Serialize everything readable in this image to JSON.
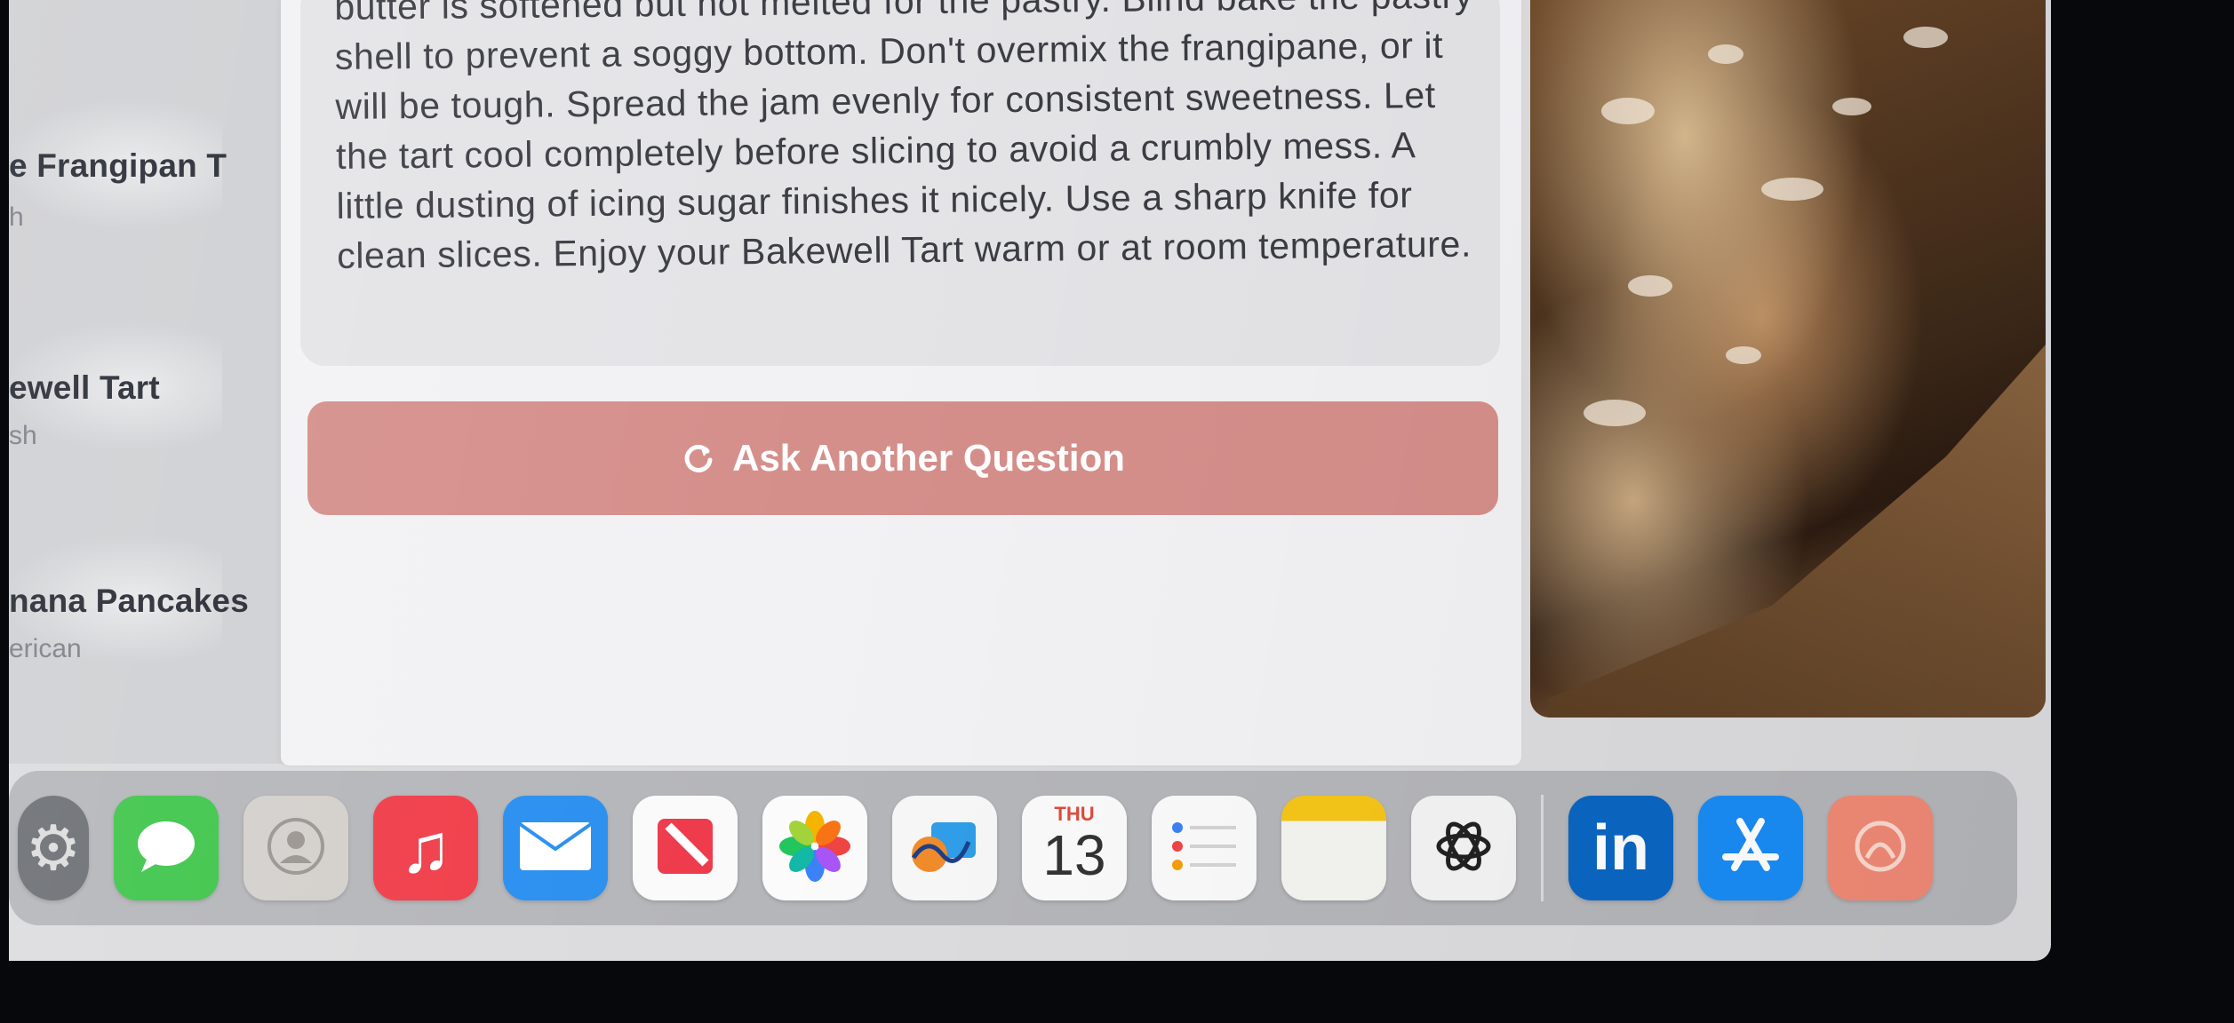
{
  "sidebar": {
    "items": [
      {
        "title": "e Frangipan T",
        "subtitle": "h"
      },
      {
        "title": "ewell Tart",
        "subtitle": "sh"
      },
      {
        "title": "nana Pancakes",
        "subtitle": "erican"
      }
    ]
  },
  "tips": {
    "text": "butter is softened but not melted for the pastry.  Blind bake the pastry shell to prevent a soggy bottom. Don't overmix the frangipane, or it will be tough.  Spread the jam evenly for consistent sweetness.  Let the tart cool completely before slicing to avoid a crumbly mess.  A little dusting of icing sugar finishes it nicely.  Use a sharp knife for clean slices.  Enjoy your Bakewell Tart warm or at room temperature."
  },
  "ask_button": {
    "label": "Ask Another Question",
    "icon": "refresh-icon",
    "color": "#d58f8b"
  },
  "dock": {
    "apps": [
      {
        "name": "system-settings",
        "icon": "gear-icon"
      },
      {
        "name": "messages",
        "icon": "speech-bubble-icon"
      },
      {
        "name": "contacts",
        "icon": "person-icon"
      },
      {
        "name": "music",
        "icon": "music-note-icon"
      },
      {
        "name": "mail",
        "icon": "envelope-icon"
      },
      {
        "name": "news",
        "icon": "news-icon"
      },
      {
        "name": "photos",
        "icon": "flower-icon"
      },
      {
        "name": "freeform",
        "icon": "freeform-icon"
      },
      {
        "name": "calendar",
        "icon": "calendar-icon",
        "day": "THU",
        "date": "13"
      },
      {
        "name": "reminders",
        "icon": "checklist-icon"
      },
      {
        "name": "notes",
        "icon": "notepad-icon"
      },
      {
        "name": "chatgpt",
        "icon": "openai-knot-icon"
      },
      {
        "name": "linkedin",
        "icon": "linkedin-icon",
        "label": "in"
      },
      {
        "name": "app-store",
        "icon": "app-store-icon"
      },
      {
        "name": "unknown-app",
        "icon": "app-icon"
      }
    ]
  }
}
